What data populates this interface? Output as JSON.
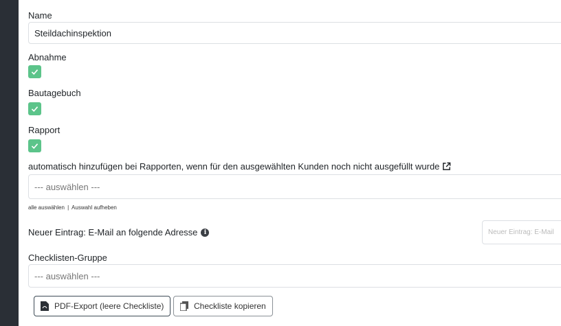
{
  "form": {
    "name_label": "Name",
    "name_value": "Steildachinspektion",
    "abnahme_label": "Abnahme",
    "bautagebuch_label": "Bautagebuch",
    "rapport_label": "Rapport",
    "auto_add_label": "automatisch hinzufügen bei Rapporten, wenn für den ausgewählten Kunden noch nicht ausgefüllt wurde",
    "auto_add_placeholder": "--- auswählen ---",
    "select_all": "alle auswählen",
    "separator": "|",
    "deselect": "Auswahl aufheben",
    "email_label": "Neuer Eintrag: E-Mail an folgende Adresse",
    "email_placeholder": "Neuer Eintrag: E-Mail",
    "group_label": "Checklisten-Gruppe",
    "group_placeholder": "--- auswählen ---"
  },
  "buttons": {
    "pdf_export": "PDF-Export (leere Checkliste)",
    "copy": "Checkliste kopieren"
  },
  "colors": {
    "checkbox": "#5cc48a",
    "background": "#2a2f36"
  },
  "checkboxes": {
    "abnahme": true,
    "bautagebuch": true,
    "rapport": true
  }
}
